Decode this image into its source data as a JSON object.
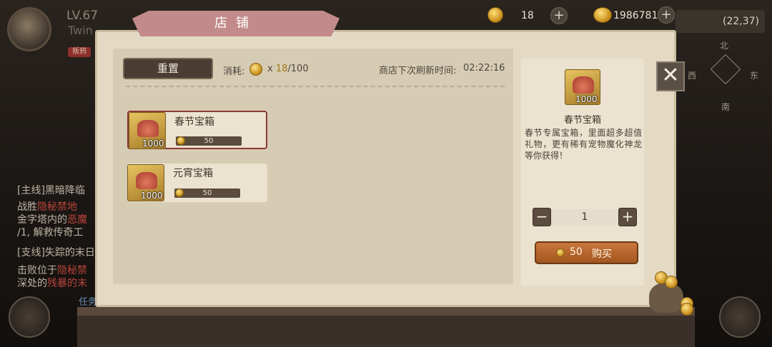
{
  "player": {
    "level": "LV.67",
    "name": "Twin",
    "tag": "叛鸦"
  },
  "quests": {
    "main_title": "[主线]黑暗降临",
    "main_line1_a": "战胜",
    "main_line1_b": "隐秘禁地",
    "main_line2_a": "金字塔内的",
    "main_line2_b": "恶魔",
    "main_line3": "/1, 解救传奇工",
    "side_title": "[支线]失踪的末日",
    "side_line1_a": "击败位于",
    "side_line1_b": "隐秘禁",
    "side_line2_a": "深处的",
    "side_line2_b": "残暴的末",
    "task_label": "任务"
  },
  "hud": {
    "coin_count": "18",
    "gold_count": "1986781",
    "plus": "+",
    "coords": "(22,37)"
  },
  "compass": {
    "north": "北",
    "west": "西",
    "east": "东",
    "south": "南"
  },
  "shop": {
    "title": "店铺",
    "reset_label": "重置",
    "cost_label": "消耗:",
    "cost_x": "x",
    "cost_used": "18",
    "cost_total": "/100",
    "refresh_text": "商店下次刷新时间:",
    "refresh_time": "02:22:16",
    "items": [
      {
        "name": "春节宝箱",
        "qty": "1000",
        "price": "50",
        "selected": true
      },
      {
        "name": "元宵宝箱",
        "qty": "1000",
        "price": "50",
        "selected": false
      }
    ],
    "detail": {
      "name": "春节宝箱",
      "qty": "1000",
      "description": "春节专属宝箱，里面超多超值礼物，更有稀有宠物魔化神龙等你获得！",
      "minus": "−",
      "plus": "+",
      "quantity": "1",
      "buy_price": "50",
      "buy_label": "购买"
    },
    "close_symbol": "✕"
  },
  "colors": {
    "accent_red": "#8a3a36",
    "panel": "#e4dac4",
    "buy": "#b8652c"
  }
}
